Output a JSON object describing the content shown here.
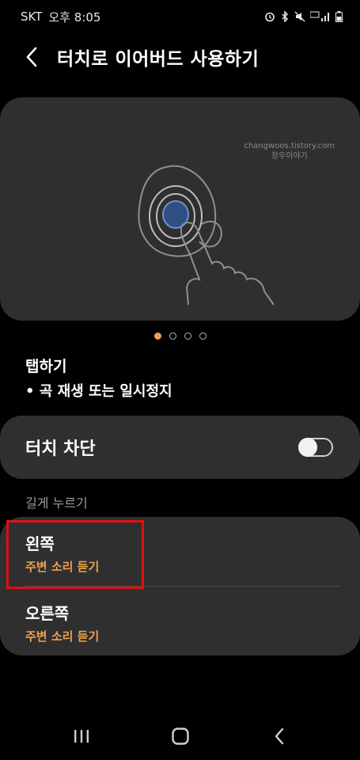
{
  "status_bar": {
    "carrier": "SKT",
    "time": "오후 8:05"
  },
  "header": {
    "title": "터치로 이어버드 사용하기"
  },
  "illustration": {
    "watermark_line1": "changwoos.tistory.com",
    "watermark_line2": "창우이야기",
    "page_count": 4,
    "active_page": 1
  },
  "gesture": {
    "title": "탭하기",
    "description": "• 곡 재생 또는 일시정지"
  },
  "touch_block": {
    "label": "터치 차단",
    "enabled": false
  },
  "long_press": {
    "section_header": "길게 누르기",
    "left": {
      "title": "왼쪽",
      "value": "주변 소리 듣기"
    },
    "right": {
      "title": "오른쪽",
      "value": "주변 소리 듣기"
    }
  },
  "colors": {
    "accent": "#f0a04b",
    "card": "#2f2f2f",
    "highlight": "#e01010"
  }
}
